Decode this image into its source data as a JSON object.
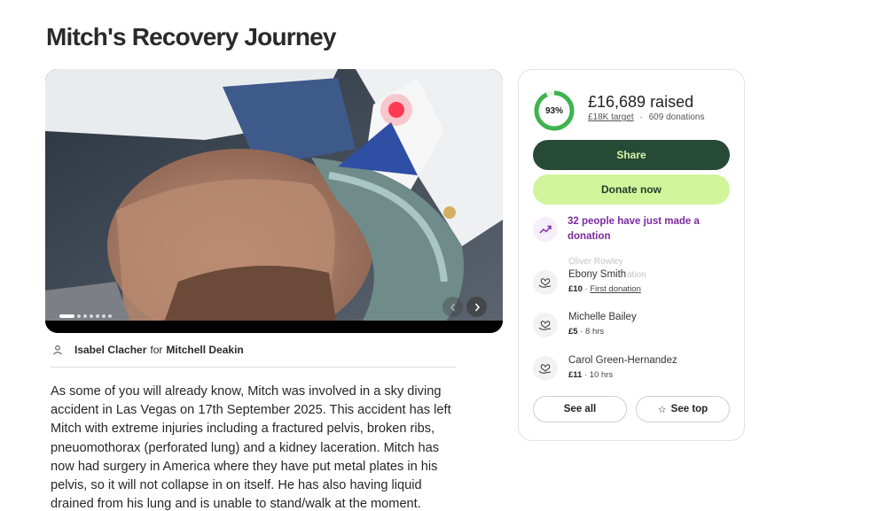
{
  "page": {
    "title": "Mitch's Recovery Journey"
  },
  "hero": {
    "slide_count": 8,
    "active_slide": 1,
    "prev_icon": "chevron-left-icon",
    "next_icon": "chevron-right-icon"
  },
  "organizer": {
    "name": "Isabel Clacher",
    "for_label": "for",
    "beneficiary": "Mitchell Deakin"
  },
  "story": {
    "text": "As some of you will already know, Mitch was involved in a sky diving accident in Las Vegas on 17th September 2025. This accident has left Mitch with extreme injuries including a fractured pelvis, broken ribs, pneuomothorax (perforated lung) and a kidney laceration. Mitch has now had surgery in America where they have put metal plates in his pelvis, so it will not collapse in on itself. He has also having liquid drained from his lung and is unable to stand/walk at the moment."
  },
  "fundraiser": {
    "progress_percent": 93,
    "progress_label": "93%",
    "raised": "£16,689 raised",
    "target": "£18K target",
    "separator": "·",
    "donations": "609 donations",
    "share_label": "Share",
    "donate_label": "Donate now",
    "trend_text": "32 people have just made a donation",
    "colors": {
      "progress_ring": "#3fb34f",
      "share_bg": "#264a35",
      "share_text": "#d8f7a8",
      "donate_bg": "#d1f59a",
      "trend_text": "#7b2a9e"
    }
  },
  "donors": [
    {
      "name": "Ebony Smith",
      "amount": "£10",
      "meta": "First donation",
      "ghost_name": "Oliver Rowley",
      "ghost_meta": "ation"
    },
    {
      "name": "Michelle Bailey",
      "amount": "£5",
      "meta": "8 hrs"
    },
    {
      "name": "Carol Green-Hernandez",
      "amount": "£11",
      "meta": "10 hrs"
    }
  ],
  "actions": {
    "see_all": "See all",
    "see_top": "See top"
  }
}
